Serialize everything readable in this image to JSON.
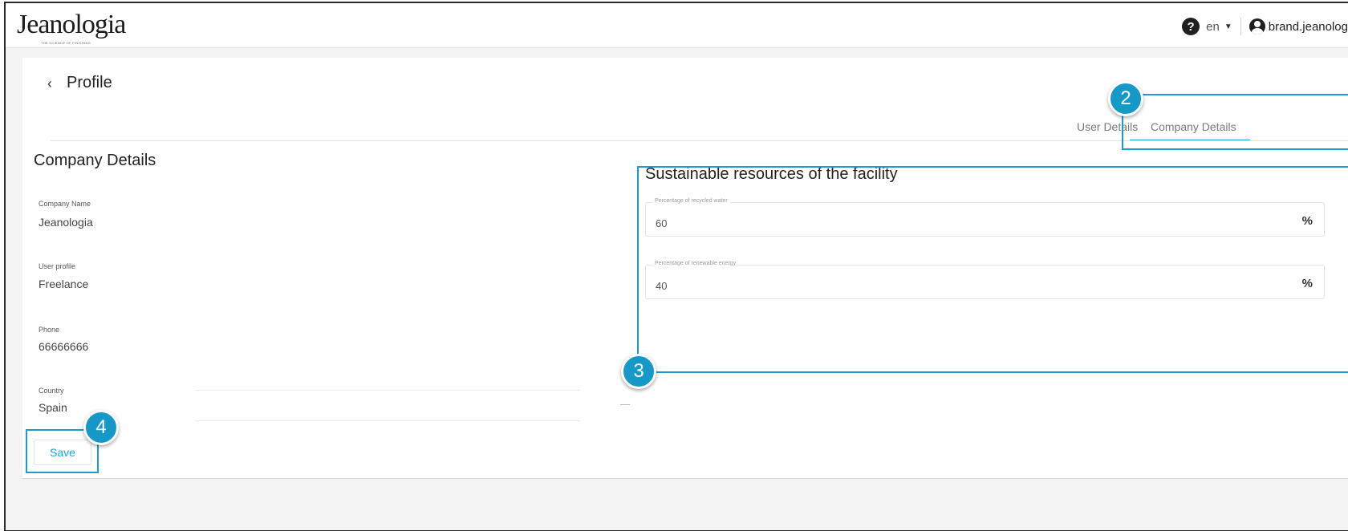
{
  "header": {
    "logo_text": "Jeanologia",
    "logo_tagline": "THE SCIENCE OF FINISHING",
    "help_icon": "question-circle-icon",
    "language": "en",
    "username": "brand.jeanolog"
  },
  "page": {
    "back_icon": "chevron-left-icon",
    "title": "Profile"
  },
  "tabs": [
    {
      "label": "User Details"
    },
    {
      "label": "Company Details",
      "active": true
    }
  ],
  "company": {
    "section_title": "Company Details",
    "fields": [
      {
        "label": "Company Name",
        "value": "Jeanologia"
      },
      {
        "label": "User profile",
        "value": "Freelance"
      },
      {
        "label": "Phone",
        "value": "66666666"
      },
      {
        "label": "Country",
        "value": "Spain"
      }
    ],
    "save_label": "Save"
  },
  "sustainable": {
    "section_title": "Sustainable resources of the facility",
    "fields": [
      {
        "label": "Percentage of recycled water",
        "value": "60",
        "suffix": "%"
      },
      {
        "label": "Percentage of renewable energy",
        "value": "40",
        "suffix": "%"
      }
    ]
  },
  "annotations": {
    "badge_2": "2",
    "badge_3": "3",
    "badge_4": "4",
    "color": "#1698c9"
  }
}
